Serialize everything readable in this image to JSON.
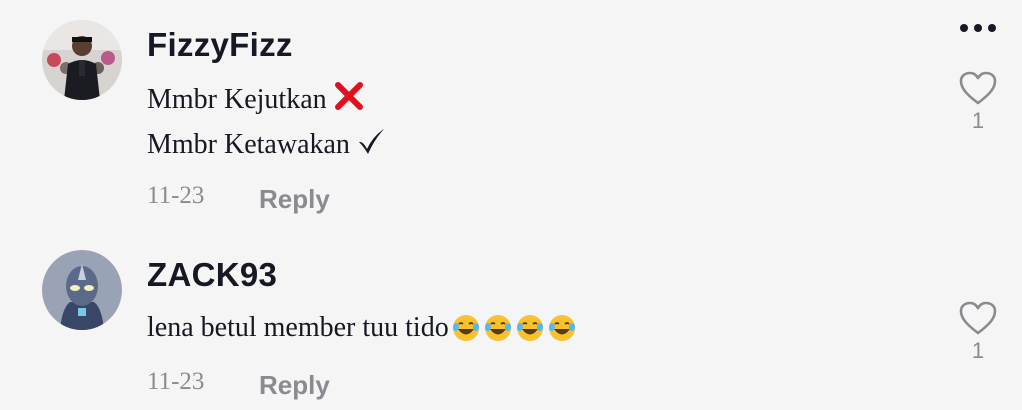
{
  "menu": {
    "icon": "more-horizontal-icon"
  },
  "comments": [
    {
      "username": "FizzyFizz",
      "lines": [
        "Mmbr Kejutkan",
        "Mmbr Ketawakan"
      ],
      "line_icons": [
        "cross-mark-icon",
        "check-mark-icon"
      ],
      "date": "11-23",
      "reply_label": "Reply",
      "like_count": "1",
      "avatar_icon": "user-avatar"
    },
    {
      "username": "ZACK93",
      "text": "lena betul member tuu tido",
      "emoji": [
        "face-with-tears-of-joy-icon",
        "face-with-tears-of-joy-icon",
        "face-with-tears-of-joy-icon",
        "face-with-tears-of-joy-icon"
      ],
      "date": "11-23",
      "reply_label": "Reply",
      "like_count": "1",
      "avatar_icon": "user-avatar"
    }
  ],
  "colors": {
    "background": "#f5f5f5",
    "username": "#161823",
    "secondary": "#8a8b91",
    "cross": "#e0101e"
  }
}
